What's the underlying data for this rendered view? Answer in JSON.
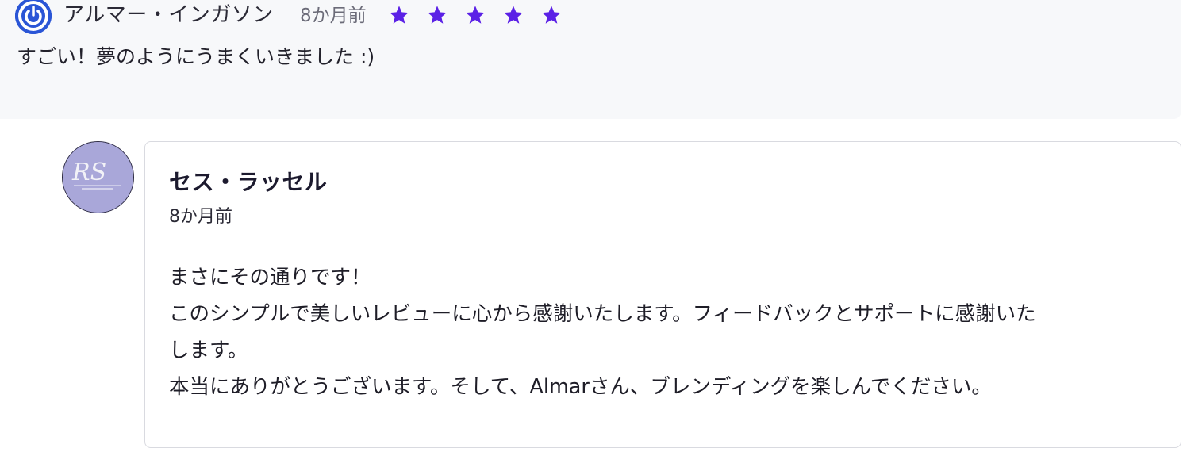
{
  "review": {
    "reviewer_name": "アルマー・インガソン",
    "time_ago": "8か月前",
    "rating": 5,
    "star_color": "#5b21e6",
    "body": "すごい！夢のようにうまくいきました :)"
  },
  "reply": {
    "author_name": "セス・ラッセル",
    "time_ago": "8か月前",
    "lines": [
      "まさにその通りです！",
      "このシンプルで美しいレビューに心から感謝いたします。フィードバックとサポートに感謝いた",
      "します。",
      "本当にありがとうございます。そして、Almarさん、ブレンディングを楽しんでください。"
    ]
  },
  "icons": {
    "reviewer_avatar": "power-avatar-icon",
    "reply_avatar": "rs-logo-avatar",
    "rating_star": "star-icon"
  },
  "colors": {
    "review_bg": "#f7f8fa",
    "avatar_blue": "#2a55d6",
    "reply_avatar_bg": "#a9a7d9"
  }
}
